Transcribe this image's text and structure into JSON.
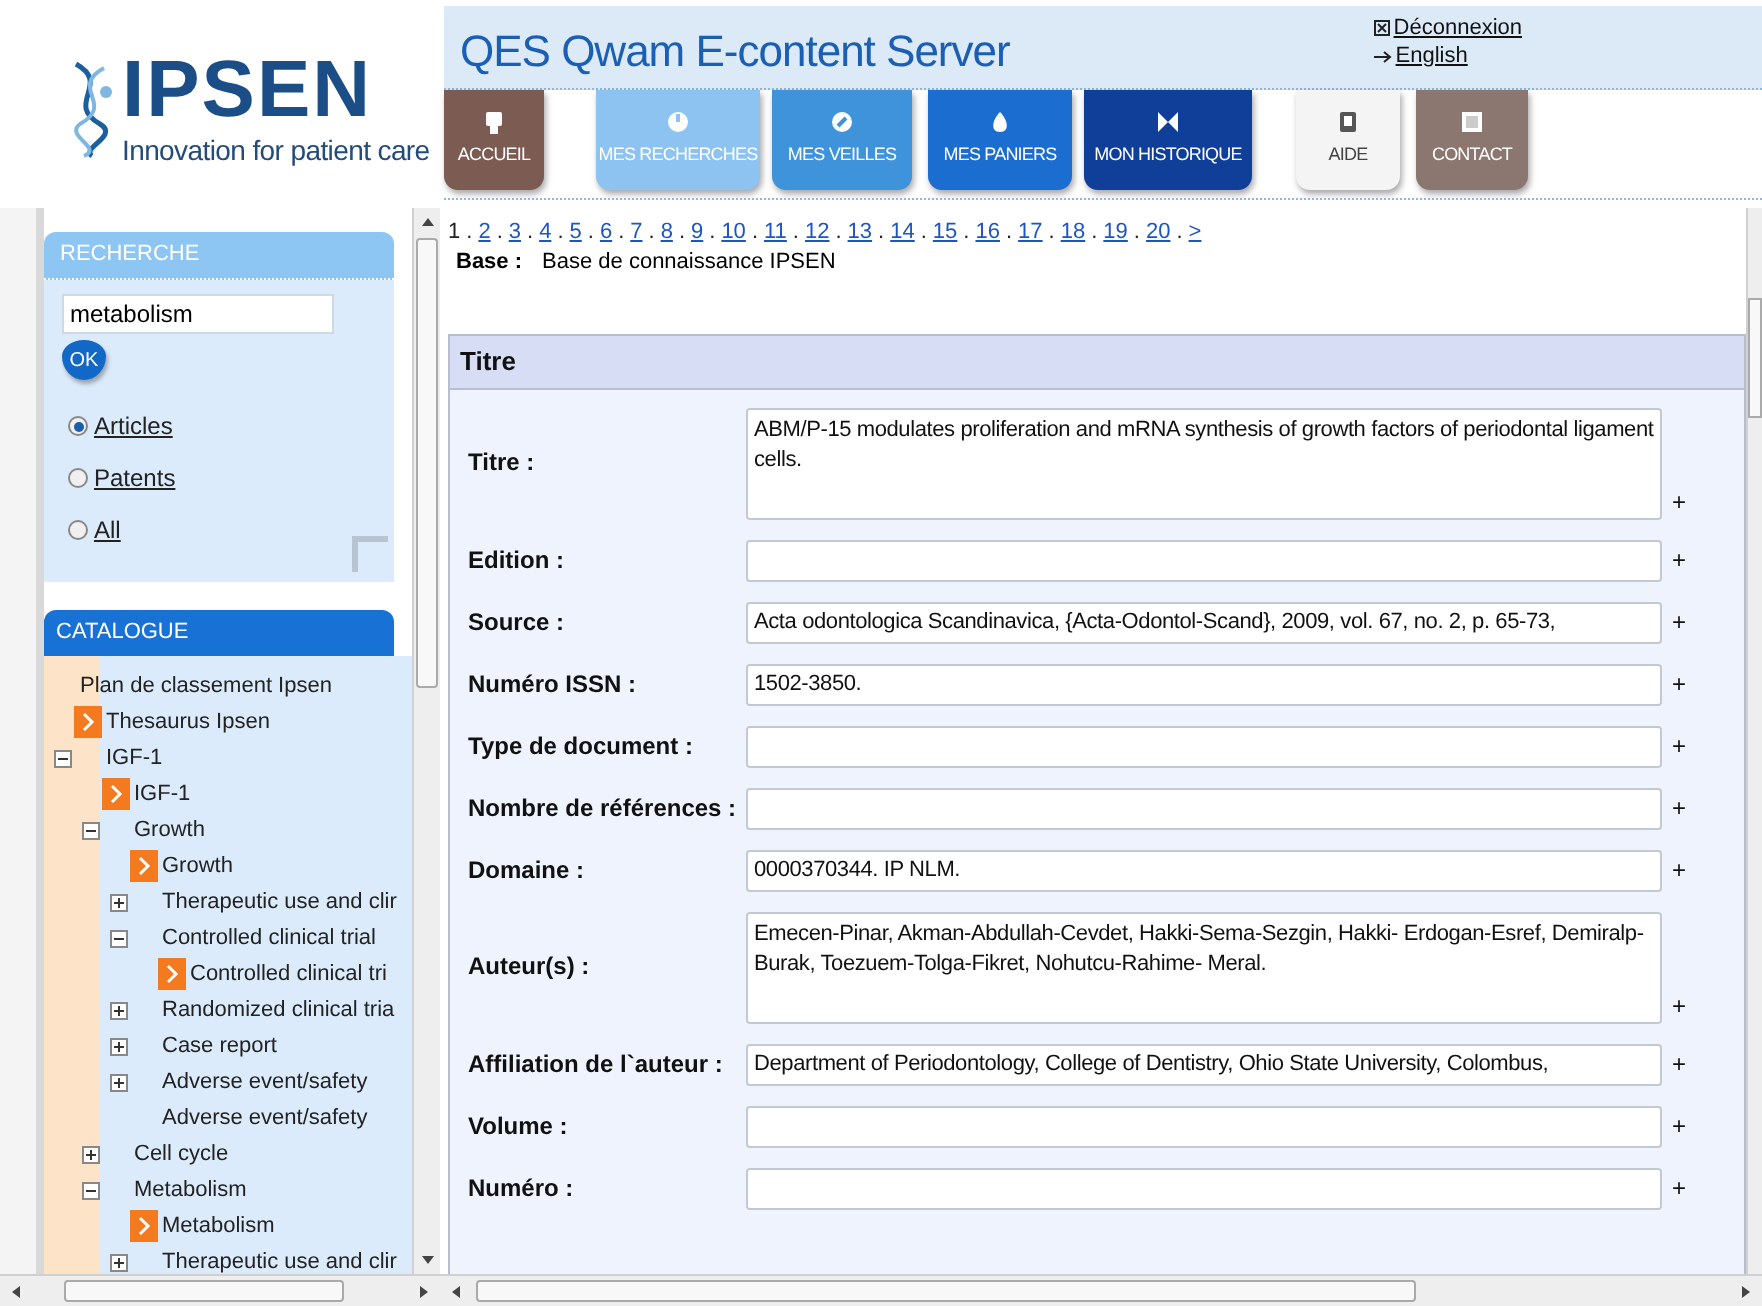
{
  "header": {
    "logo": {
      "name": "IPSEN",
      "tagline": "Innovation for patient care"
    },
    "title": "QES Qwam E-content Server",
    "links": [
      {
        "kind": "logout",
        "label": "Déconnexion"
      },
      {
        "kind": "language",
        "label": "English"
      }
    ]
  },
  "nav": [
    {
      "label": "ACCUEIL",
      "color": "#7b5b52"
    },
    {
      "label": "MES RECHERCHES",
      "color": "#8dc3f1"
    },
    {
      "label": "MES VEILLES",
      "color": "#3f93da"
    },
    {
      "label": "MES PANIERS",
      "color": "#1b6dd0"
    },
    {
      "label": "MON HISTORIQUE",
      "color": "#0f3f98"
    },
    {
      "label": "AIDE",
      "color": "#f4f4f4"
    },
    {
      "label": "CONTACT",
      "color": "#8b7770"
    }
  ],
  "search": {
    "title": "RECHERCHE",
    "query": "metabolism",
    "button": "OK",
    "scopes": [
      {
        "label": "Articles",
        "selected": true
      },
      {
        "label": "Patents",
        "selected": false
      },
      {
        "label": "All",
        "selected": false
      }
    ]
  },
  "catalogue": {
    "title": "CATALOGUE",
    "tree": [
      {
        "kind": "label",
        "label": "Plan de classement Ipsen",
        "children": [
          {
            "kind": "link",
            "label": "Thesaurus Ipsen"
          },
          {
            "kind": "folder",
            "label": "IGF-1",
            "expanded": true,
            "children": [
              {
                "kind": "link",
                "label": "IGF-1"
              },
              {
                "kind": "folder",
                "label": "Growth",
                "expanded": true,
                "children": [
                  {
                    "kind": "link",
                    "label": "Growth"
                  },
                  {
                    "kind": "folder",
                    "label": "Therapeutic use and clir",
                    "expanded": false
                  },
                  {
                    "kind": "folder",
                    "label": "Controlled clinical trial",
                    "expanded": true,
                    "children": [
                      {
                        "kind": "link",
                        "label": "Controlled clinical tri"
                      }
                    ]
                  },
                  {
                    "kind": "folder",
                    "label": "Randomized clinical tria",
                    "expanded": false
                  },
                  {
                    "kind": "folder",
                    "label": "Case report",
                    "expanded": false
                  },
                  {
                    "kind": "folder",
                    "label": "Adverse event/safety",
                    "expanded": false
                  },
                  {
                    "kind": "label",
                    "label": "Adverse event/safety"
                  }
                ]
              },
              {
                "kind": "folder",
                "label": "Cell cycle",
                "expanded": false
              },
              {
                "kind": "folder",
                "label": "Metabolism",
                "expanded": true,
                "children": [
                  {
                    "kind": "link",
                    "label": "Metabolism"
                  },
                  {
                    "kind": "folder",
                    "label": "Therapeutic use and clir",
                    "expanded": false
                  }
                ]
              }
            ]
          }
        ]
      }
    ]
  },
  "pagination": {
    "pages": [
      {
        "label": "1",
        "selected": true,
        "separator": "."
      },
      {
        "label": "2",
        "selected": false,
        "separator": "."
      },
      {
        "label": "3",
        "selected": false,
        "separator": "."
      },
      {
        "label": "4",
        "selected": false,
        "separator": "."
      },
      {
        "label": "5",
        "selected": false,
        "separator": "."
      },
      {
        "label": "6",
        "selected": false,
        "separator": "."
      },
      {
        "label": "7",
        "selected": false,
        "separator": "."
      },
      {
        "label": "8",
        "selected": false,
        "separator": "."
      },
      {
        "label": "9",
        "selected": false,
        "separator": "."
      },
      {
        "label": "10",
        "selected": false,
        "separator": "."
      },
      {
        "label": "11",
        "selected": false,
        "separator": "."
      },
      {
        "label": "12",
        "selected": false,
        "separator": "."
      },
      {
        "label": "13",
        "selected": false,
        "separator": "."
      },
      {
        "label": "14",
        "selected": false,
        "separator": "."
      },
      {
        "label": "15",
        "selected": false,
        "separator": "."
      },
      {
        "label": "16",
        "selected": false,
        "separator": "."
      },
      {
        "label": "17",
        "selected": false,
        "separator": "."
      },
      {
        "label": "18",
        "selected": false,
        "separator": "."
      },
      {
        "label": "19",
        "selected": false,
        "separator": "."
      },
      {
        "label": "20",
        "selected": false,
        "separator": "."
      },
      {
        "label": ">",
        "selected": false
      }
    ]
  },
  "base": {
    "label": "Base :",
    "value": "Base de connaissance IPSEN"
  },
  "section": {
    "title": "Titre",
    "fields": [
      {
        "kind": "textarea",
        "label": "Titre :",
        "value": "ABM/P-15 modulates proliferation and mRNA synthesis of growth factors of periodontal ligament cells.",
        "add": "+"
      },
      {
        "kind": "input",
        "label": "Edition :",
        "add": "+"
      },
      {
        "kind": "input",
        "label": "Source :",
        "value": "Acta odontologica Scandinavica, {Acta-Odontol-Scand}, 2009, vol. 67, no. 2, p. 65-73,",
        "add": "+"
      },
      {
        "kind": "input",
        "label": "Numéro ISSN :",
        "value": "1502-3850.",
        "add": "+"
      },
      {
        "kind": "input",
        "label": "Type de document :",
        "add": "+"
      },
      {
        "kind": "input",
        "label": "Nombre de références :",
        "add": "+"
      },
      {
        "kind": "input",
        "label": "Domaine :",
        "value": "0000370344. IP NLM.",
        "add": "+"
      },
      {
        "kind": "textarea",
        "label": "Auteur(s) :",
        "value": "Emecen-Pinar, Akman-Abdullah-Cevdet, Hakki-Sema-Sezgin, Hakki- Erdogan-Esref, Demiralp-Burak, Toezuem-Tolga-Fikret, Nohutcu-Rahime- Meral.",
        "add": "+"
      },
      {
        "kind": "input",
        "label": "Affiliation de l`auteur :",
        "value": "Department of Periodontology, College of Dentistry, Ohio State University, Colombus,",
        "add": "+"
      },
      {
        "kind": "input",
        "label": "Volume :",
        "add": "+"
      },
      {
        "kind": "input",
        "label": "Numéro :",
        "add": "+"
      }
    ]
  }
}
